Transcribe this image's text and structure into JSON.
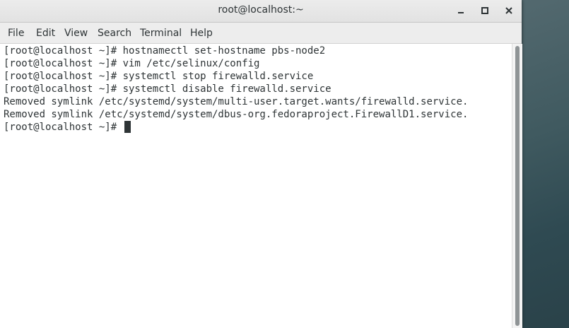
{
  "window": {
    "title": "root@localhost:~"
  },
  "menubar": {
    "items": [
      "File",
      "Edit",
      "View",
      "Search",
      "Terminal",
      "Help"
    ]
  },
  "terminal": {
    "lines": [
      "[root@localhost ~]# hostnamectl set-hostname pbs-node2",
      "[root@localhost ~]# vim /etc/selinux/config",
      "[root@localhost ~]# systemctl stop firewalld.service",
      "[root@localhost ~]# systemctl disable firewalld.service",
      "Removed symlink /etc/systemd/system/multi-user.target.wants/firewalld.service.",
      "Removed symlink /etc/systemd/system/dbus-org.fedoraproject.FirewallD1.service.",
      "[root@localhost ~]#"
    ]
  },
  "icons": {
    "minimize": "minimize-icon",
    "maximize": "maximize-icon",
    "close": "close-icon"
  }
}
